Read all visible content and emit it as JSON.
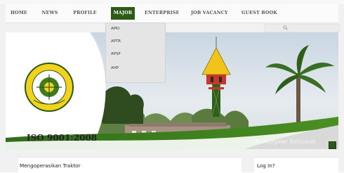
{
  "nav": {
    "items": [
      {
        "label": "HOME"
      },
      {
        "label": "NEWS"
      },
      {
        "label": "PROFILE"
      },
      {
        "label": "MAJOR",
        "active": true
      },
      {
        "label": "ENTERPRISE"
      },
      {
        "label": "JOB VACANCY"
      },
      {
        "label": "GUEST BOOK"
      }
    ]
  },
  "dropdown": {
    "items": [
      "APKI",
      "APTR",
      "APSP",
      "AHP"
    ]
  },
  "banner": {
    "iso_text": "ISO 9001:2008",
    "logo_text": "SEKOLAH PERTANIAN PEMBANGUNAN • MALANG",
    "signature_text": "On Mulyono Setiawan"
  },
  "content": {
    "main_title": "Mengoperasikan Traktor",
    "side_title": "Log In?"
  },
  "colors": {
    "accent_green": "#2c5a17",
    "logo_yellow": "#f2d21c"
  }
}
